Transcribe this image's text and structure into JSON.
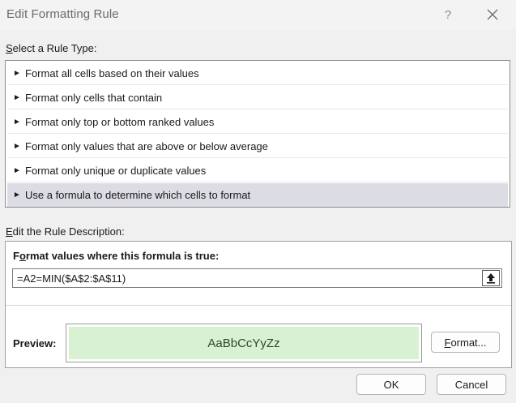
{
  "window": {
    "title": "Edit Formatting Rule",
    "help_label": "?",
    "close_icon": "close-icon"
  },
  "rule_type": {
    "label_prefix": "S",
    "label_rest": "elect a Rule Type:",
    "items": [
      {
        "label": "Format all cells based on their values",
        "selected": false
      },
      {
        "label": "Format only cells that contain",
        "selected": false
      },
      {
        "label": "Format only top or bottom ranked values",
        "selected": false
      },
      {
        "label": "Format only values that are above or below average",
        "selected": false
      },
      {
        "label": "Format only unique or duplicate values",
        "selected": false
      },
      {
        "label": "Use a formula to determine which cells to format",
        "selected": true
      }
    ]
  },
  "description": {
    "label_prefix": "E",
    "label_rest": "dit the Rule Description:",
    "formula_label_prefix": "F",
    "formula_label_mid": "o",
    "formula_label_rest": "rmat values where this formula is true:",
    "formula_value": "=A2=MIN($A$2:$A$11)",
    "preview_label": "Preview:",
    "preview_text": "AaBbCcYyZz",
    "preview_fill": "#d9f1d3",
    "format_button_prefix": "F",
    "format_button_rest": "ormat..."
  },
  "footer": {
    "ok_label": "OK",
    "cancel_label": "Cancel"
  }
}
